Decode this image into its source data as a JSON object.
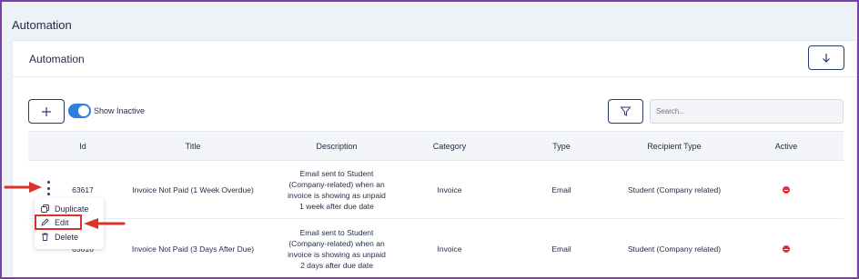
{
  "page": {
    "title": "Automation"
  },
  "card": {
    "title": "Automation",
    "toggle_label": "Show Inactive",
    "search_placeholder": "Search..."
  },
  "table": {
    "columns": [
      "Id",
      "Title",
      "Description",
      "Category",
      "Type",
      "Recipient Type",
      "Active"
    ],
    "rows": [
      {
        "id": "63617",
        "title": "Invoice Not Paid (1 Week Overdue)",
        "description": [
          "Email sent to Student",
          "(Company-related) when an",
          "invoice is showing as unpaid",
          "1 week after due date"
        ],
        "category": "Invoice",
        "type": "Email",
        "recipient_type": "Student (Company related)",
        "active": false
      },
      {
        "id": "63616",
        "title": "Invoice Not Paid (3 Days After Due)",
        "description": [
          "Email sent to Student",
          "(Company-related) when an",
          "invoice is showing as unpaid",
          "2 days after due date"
        ],
        "category": "Invoice",
        "type": "Email",
        "recipient_type": "Student (Company related)",
        "active": false
      }
    ]
  },
  "row_menu": {
    "items": [
      {
        "label": "Duplicate",
        "icon": "copy-icon"
      },
      {
        "label": "Edit",
        "icon": "pencil-icon"
      },
      {
        "label": "Delete",
        "icon": "trash-icon"
      }
    ]
  },
  "colors": {
    "accent": "#2f7ee0",
    "annotation": "#d9342b",
    "frame": "#7b3fa6",
    "inactive": "#e0303f"
  }
}
